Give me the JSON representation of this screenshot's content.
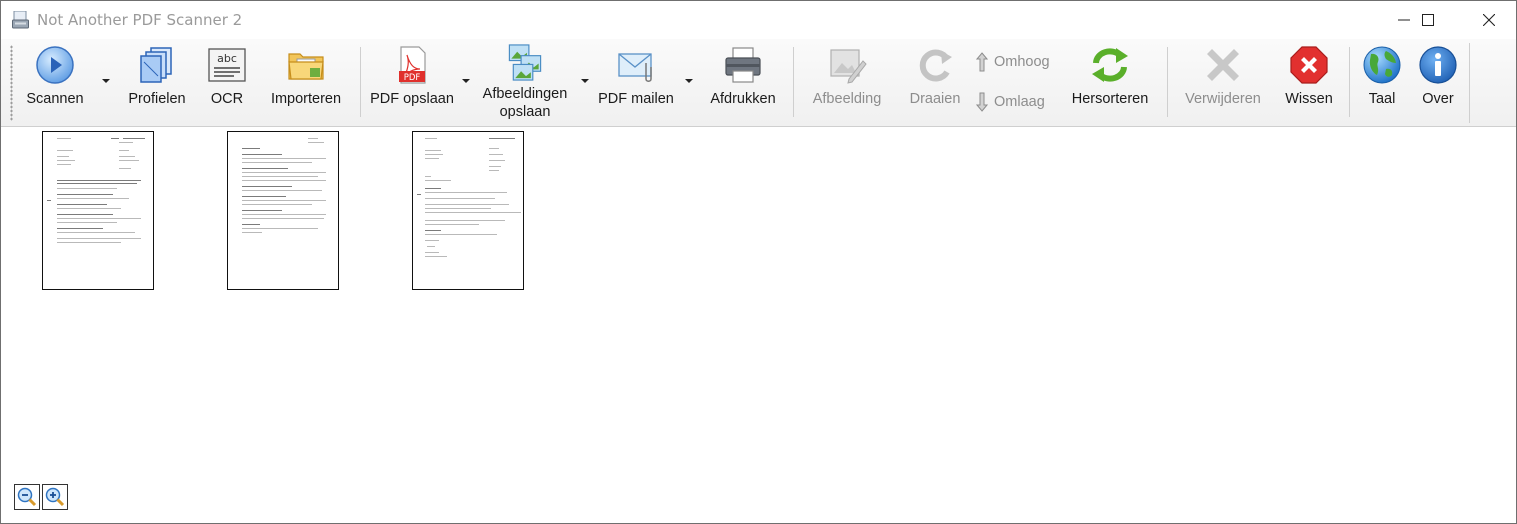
{
  "window": {
    "title": "Not Another PDF Scanner 2",
    "minimize_icon": "minimize-icon",
    "maximize_icon": "maximize-icon",
    "close_icon": "close-icon"
  },
  "toolbar": {
    "scan": "Scannen",
    "profiles": "Profielen",
    "ocr": "OCR",
    "ocr_icon_text": "abc",
    "import": "Importeren",
    "save_pdf": "PDF opslaan",
    "pdf_icon_text": "PDF",
    "save_images_line1": "Afbeeldingen",
    "save_images_line2": "opslaan",
    "email_pdf": "PDF mailen",
    "print": "Afdrukken",
    "image": "Afbeelding",
    "rotate": "Draaien",
    "move_up": "Omhoog",
    "move_down": "Omlaag",
    "reorder": "Hersorteren",
    "delete": "Verwijderen",
    "clear": "Wissen",
    "language": "Taal",
    "about": "Over"
  },
  "colors": {
    "accent_blue": "#3a7bd5",
    "pdf_red": "#e0302c",
    "green": "#5aaf2a",
    "red": "#e2302f",
    "disabled": "#8d8d8d"
  },
  "pages": [
    {
      "name": "page-1"
    },
    {
      "name": "page-2"
    },
    {
      "name": "page-3"
    }
  ],
  "zoom": {
    "zoom_out_icon": "zoom-out-icon",
    "zoom_in_icon": "zoom-in-icon"
  }
}
